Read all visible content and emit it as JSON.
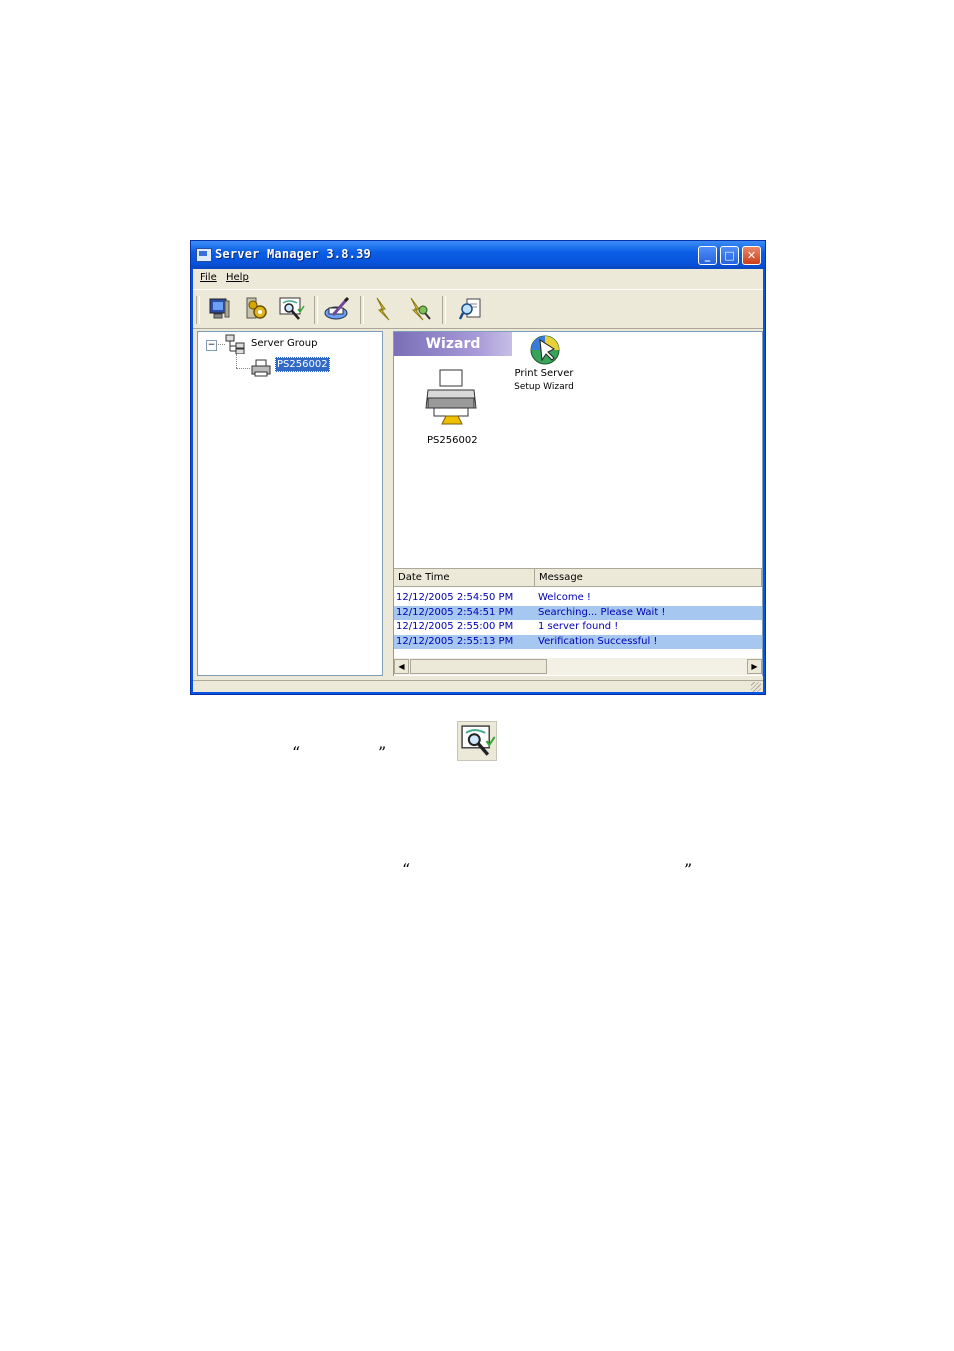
{
  "window": {
    "title": "Server Manager 3.8.39",
    "controls": {
      "minimize": "_",
      "maximize": "□",
      "close": "✕"
    }
  },
  "menu": {
    "file": "File",
    "help": "Help"
  },
  "toolbar": {
    "icons": [
      "monitor-icon",
      "settings-gear-icon",
      "verify-magnifier-icon",
      "edit-pen-icon",
      "lightning-icon",
      "lightning-check-icon",
      "search-document-icon"
    ]
  },
  "tree": {
    "collapse_glyph": "−",
    "root_label": "Server Group",
    "child_label": "PS256002"
  },
  "wizard": {
    "banner": "Wizard",
    "printer_label": "PS256002",
    "setup_label_line1": "Print Server",
    "setup_label_line2": "Setup Wizard"
  },
  "log": {
    "headers": {
      "datetime": "Date Time",
      "message": "Message"
    },
    "rows": [
      {
        "datetime": "12/12/2005 2:54:50 PM",
        "message": "Welcome !",
        "highlight": false
      },
      {
        "datetime": "12/12/2005 2:54:51 PM",
        "message": "Searching... Please Wait !",
        "highlight": true
      },
      {
        "datetime": "12/12/2005 2:55:00 PM",
        "message": "1 server found !",
        "highlight": false
      },
      {
        "datetime": "12/12/2005 2:55:13 PM",
        "message": "Verification Successful !",
        "highlight": true
      }
    ],
    "scroll_left": "◀",
    "scroll_right": "▶"
  },
  "doc": {
    "quote_open_1": "“",
    "quote_close_1": "”",
    "quote_open_2": "“",
    "quote_close_2": "”"
  },
  "colors": {
    "titlebar": "#0a5fe6",
    "highlight_row": "#a6c8f0",
    "selection": "#3169c6",
    "wizard_banner": "#a79ad8"
  }
}
